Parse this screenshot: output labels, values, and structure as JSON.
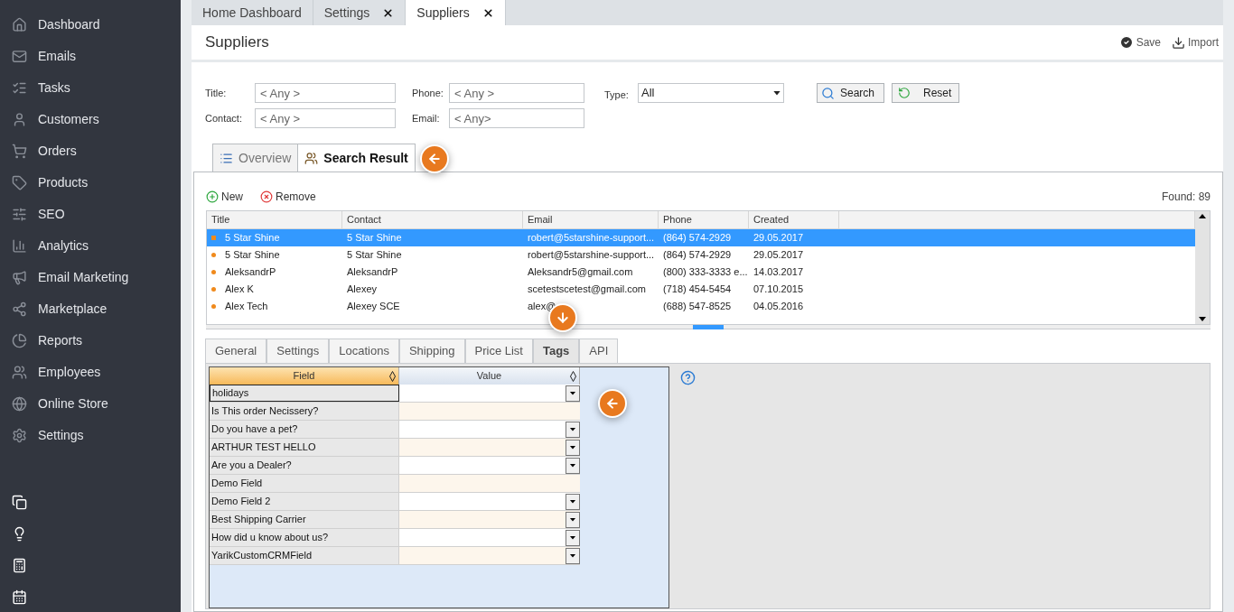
{
  "sidebar": {
    "items": [
      {
        "label": "Dashboard"
      },
      {
        "label": "Emails"
      },
      {
        "label": "Tasks"
      },
      {
        "label": "Customers"
      },
      {
        "label": "Orders"
      },
      {
        "label": "Products"
      },
      {
        "label": "SEO"
      },
      {
        "label": "Analytics"
      },
      {
        "label": "Email Marketing"
      },
      {
        "label": "Marketplace"
      },
      {
        "label": "Reports"
      },
      {
        "label": "Employees"
      },
      {
        "label": "Online Store"
      },
      {
        "label": "Settings"
      }
    ]
  },
  "top_tabs": [
    {
      "label": "Home Dashboard",
      "closable": false,
      "selected": false
    },
    {
      "label": "Settings",
      "closable": true,
      "selected": false
    },
    {
      "label": "Suppliers",
      "closable": true,
      "selected": true
    }
  ],
  "header": {
    "title": "Suppliers",
    "actions": [
      "Save",
      "Import"
    ]
  },
  "filters": {
    "fields": [
      {
        "label": "Title:",
        "placeholder": "< Any >"
      },
      {
        "label": "Phone:",
        "placeholder": "< Any >"
      },
      {
        "label": "Contact:",
        "placeholder": "< Any >"
      },
      {
        "label": "Email:",
        "placeholder": "< Any>"
      }
    ],
    "type": {
      "label": "Type:",
      "value": "All"
    },
    "buttons": [
      "Search",
      "Reset"
    ]
  },
  "view_tabs": [
    {
      "label": "Overview",
      "selected": false
    },
    {
      "label": "Search Result",
      "selected": true
    }
  ],
  "toolbar": {
    "buttons": [
      "New",
      "Remove"
    ],
    "found": "Found: 89"
  },
  "grid": {
    "columns": [
      "Title",
      "Contact",
      "Email",
      "Phone",
      "Created"
    ],
    "rows": [
      {
        "selected": true,
        "cells": [
          "5 Star Shine",
          "5 Star Shine",
          "robert@5starshine-support...",
          "(864) 574-2929",
          "29.05.2017"
        ]
      },
      {
        "selected": false,
        "cells": [
          "5 Star Shine",
          "5 Star Shine",
          "robert@5starshine-support...",
          "(864) 574-2929",
          "29.05.2017"
        ]
      },
      {
        "selected": false,
        "cells": [
          "AleksandrP",
          "AleksandrP",
          "Aleksandr5@gmail.com",
          "(800) 333-3333  e...",
          "14.03.2017"
        ]
      },
      {
        "selected": false,
        "cells": [
          "Alex K",
          "Alexey",
          "scetestscetest@gmail.com",
          "(718) 454-5454",
          "07.10.2015"
        ]
      },
      {
        "selected": false,
        "cells": [
          "Alex Tech",
          "Alexey SCE",
          "alex@",
          "(688) 547-8525",
          "04.05.2016"
        ]
      }
    ]
  },
  "detail_tabs": [
    {
      "label": "General",
      "selected": false
    },
    {
      "label": "Settings",
      "selected": false
    },
    {
      "label": "Locations",
      "selected": false
    },
    {
      "label": "Shipping",
      "selected": false
    },
    {
      "label": "Price List",
      "selected": false
    },
    {
      "label": "Tags",
      "selected": true
    },
    {
      "label": "API",
      "selected": false
    }
  ],
  "tags": {
    "columns": [
      "Field",
      "Value"
    ],
    "rows": [
      {
        "field": "holidays",
        "kind": "dropdown",
        "selected": true
      },
      {
        "field": "Is This order Necissery?",
        "kind": "text",
        "selected": false
      },
      {
        "field": "Do you have a pet?",
        "kind": "dropdown",
        "selected": false
      },
      {
        "field": "ARTHUR TEST HELLO",
        "kind": "dropdown",
        "selected": false
      },
      {
        "field": "Are you a Dealer?",
        "kind": "dropdown",
        "selected": false
      },
      {
        "field": "Demo Field",
        "kind": "text",
        "selected": false
      },
      {
        "field": "Demo Field 2",
        "kind": "dropdown",
        "selected": false
      },
      {
        "field": "Best Shipping Carrier",
        "kind": "dropdown",
        "selected": false
      },
      {
        "field": "How did u know about us?",
        "kind": "dropdown",
        "selected": false
      },
      {
        "field": "YarikCustomCRMField",
        "kind": "dropdown",
        "selected": false
      }
    ]
  }
}
